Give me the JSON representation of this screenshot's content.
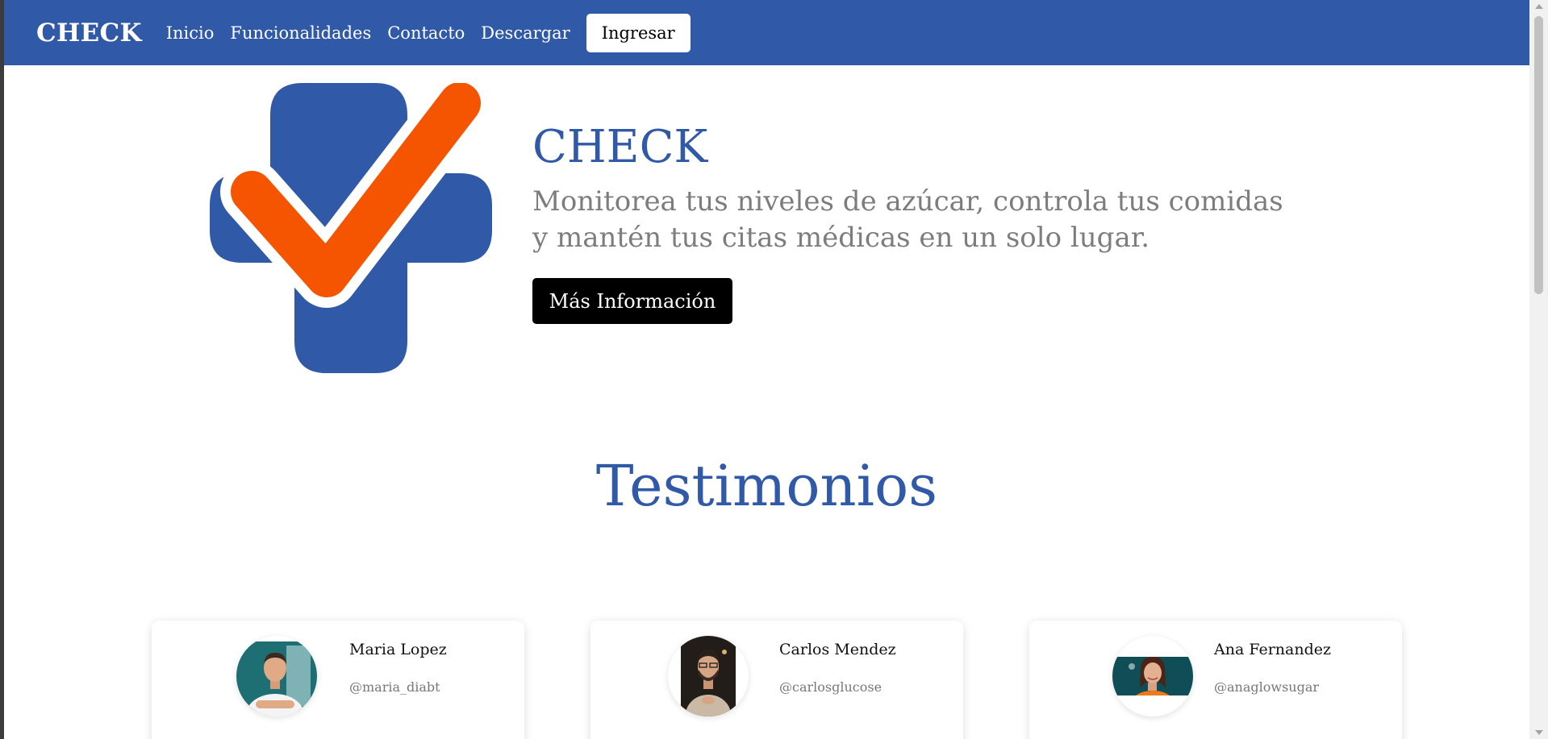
{
  "navbar": {
    "brand": "CHECK",
    "links": [
      "Inicio",
      "Funcionalidades",
      "Contacto",
      "Descargar"
    ],
    "login_label": "Ingresar"
  },
  "hero": {
    "title": "CHECK",
    "subtitle": "Monitorea tus niveles de azúcar, controla tus comidas y mantén tus citas médicas en un solo lugar.",
    "button_label": "Más Información",
    "logo_icon": "medical-cross-check-logo-icon"
  },
  "testimonials": {
    "title": "Testimonios",
    "items": [
      {
        "name": "Maria Lopez",
        "handle": "@maria_diabt"
      },
      {
        "name": "Carlos Mendez",
        "handle": "@carlosglucose"
      },
      {
        "name": "Ana Fernandez",
        "handle": "@anaglowsugar"
      }
    ]
  },
  "colors": {
    "primary": "#3059a8",
    "accent": "#f55500",
    "button_dark": "#000000"
  }
}
